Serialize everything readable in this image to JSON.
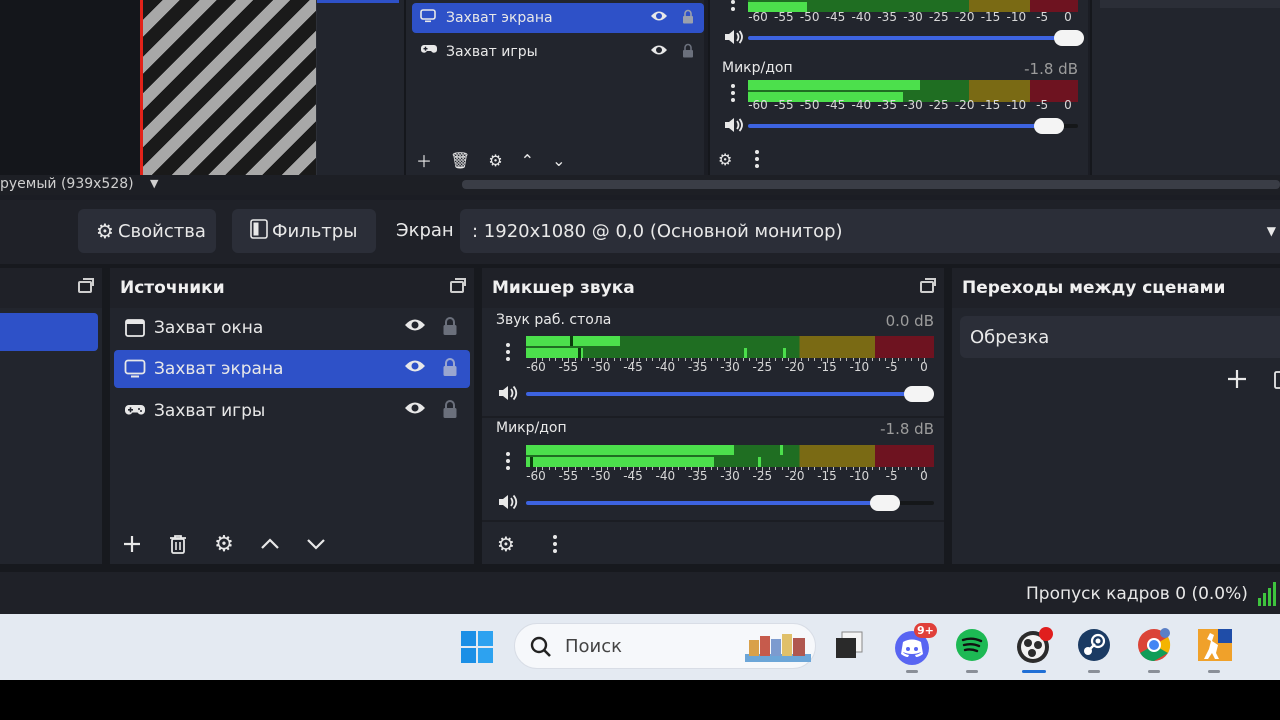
{
  "top_ghost": {
    "sources": [
      {
        "label": "Захват экрана",
        "icon": "monitor-icon",
        "selected": true
      },
      {
        "label": "Захват игры",
        "icon": "gamepad-icon",
        "selected": false
      }
    ],
    "mixer": {
      "channels": [
        {
          "name": "",
          "db": ""
        },
        {
          "name": "Микр/доп",
          "db": "-1.8 dB"
        }
      ],
      "scale": [
        "-60",
        "-55",
        "-50",
        "-45",
        "-40",
        "-35",
        "-30",
        "-25",
        "-20",
        "-15",
        "-10",
        "-5",
        "0"
      ]
    },
    "status_text": "руемый (939x528)"
  },
  "properties_bar": {
    "properties_label": "Свойства",
    "filters_label": "Фильтры",
    "screen_label": "Экран",
    "screen_value": ": 1920x1080 @ 0,0 (Основной монитор)"
  },
  "sources": {
    "title": "Источники",
    "items": [
      {
        "label": "Захват окна",
        "icon": "window-icon",
        "selected": false
      },
      {
        "label": "Захват экрана",
        "icon": "monitor-icon",
        "selected": true
      },
      {
        "label": "Захват игры",
        "icon": "gamepad-icon",
        "selected": false
      }
    ]
  },
  "mixer": {
    "title": "Микшер звука",
    "scale": [
      "-60",
      "-55",
      "-50",
      "-45",
      "-40",
      "-35",
      "-30",
      "-25",
      "-20",
      "-15",
      "-10",
      "-5",
      "0"
    ],
    "channels": [
      {
        "name": "Звук раб. стола",
        "db": "0.0 dB",
        "volume": 1.0,
        "level_top": 0.23,
        "level_bottom": 0.14
      },
      {
        "name": "Микр/доп",
        "db": "-1.8 dB",
        "volume": 0.87,
        "level_top": 0.51,
        "level_bottom": 0.46
      }
    ]
  },
  "transitions": {
    "title": "Переходы между сценами",
    "current": "Обрезка"
  },
  "status": {
    "dropped_frames": "Пропуск кадров 0 (0.0%)"
  },
  "taskbar": {
    "search_label": "Поиск",
    "discord_badge": "9+",
    "apps": [
      "windows-start-icon",
      "search-highlight-icon",
      "task-view-icon",
      "discord-icon",
      "spotify-icon",
      "obs-icon",
      "steam-icon",
      "chrome-icon",
      "game-icon"
    ]
  },
  "colors": {
    "accent": "#2e51c8",
    "panel": "#22252d",
    "meter_green": "#4ce04c",
    "meter_yellow": "#7a6a14",
    "meter_red": "#6e1320"
  }
}
